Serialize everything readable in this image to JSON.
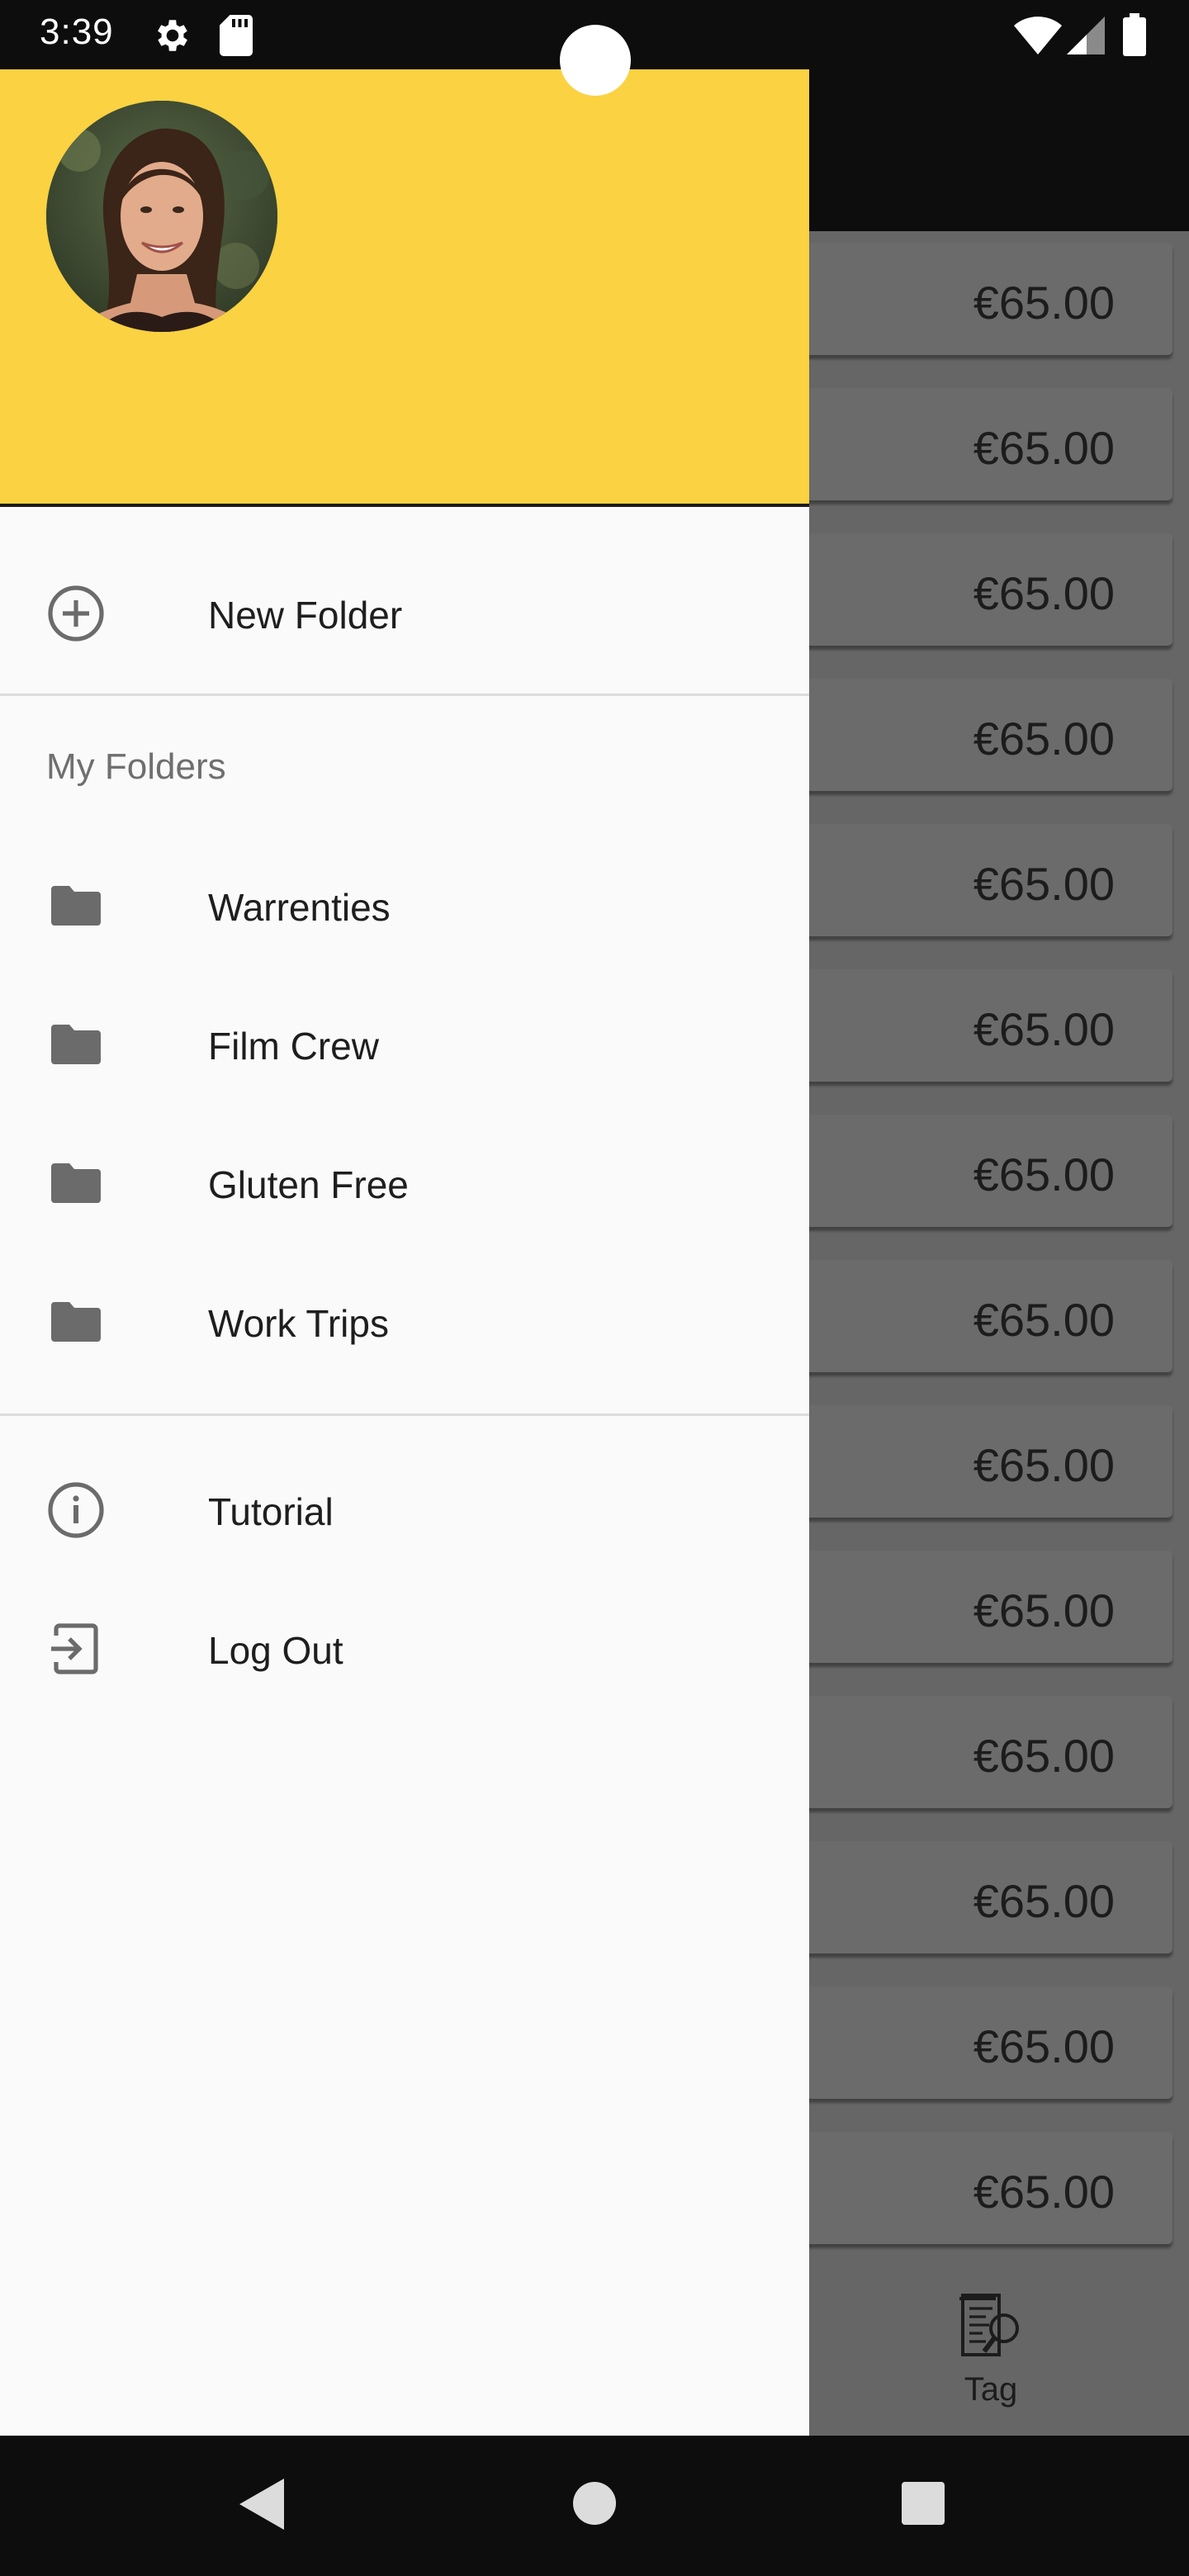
{
  "status_bar": {
    "time": "3:39",
    "icons": [
      "settings-icon",
      "sd-card-icon",
      "wifi-icon",
      "signal-icon",
      "battery-icon"
    ]
  },
  "background": {
    "amounts": [
      "€65.00",
      "€65.00",
      "€65.00",
      "€65.00",
      "€65.00",
      "€65.00",
      "€65.00",
      "€65.00",
      "€65.00",
      "€65.00",
      "€65.00",
      "€65.00",
      "€65.00",
      "€65.00"
    ],
    "bottom_tab": {
      "label": "Tag",
      "icon": "tag-receipt-icon"
    }
  },
  "drawer": {
    "header_color": "#fad242",
    "new_folder": {
      "label": "New Folder",
      "icon": "add-circle-icon"
    },
    "section_title": "My Folders",
    "folders": [
      {
        "label": "Warrenties",
        "icon": "folder-icon"
      },
      {
        "label": "Film Crew",
        "icon": "folder-icon"
      },
      {
        "label": "Gluten Free",
        "icon": "folder-icon"
      },
      {
        "label": "Work Trips",
        "icon": "folder-icon"
      }
    ],
    "tutorial": {
      "label": "Tutorial",
      "icon": "info-icon"
    },
    "logout": {
      "label": "Log Out",
      "icon": "logout-icon"
    }
  },
  "nav_bar": {
    "buttons": [
      "back-icon",
      "home-icon",
      "recents-icon"
    ]
  }
}
